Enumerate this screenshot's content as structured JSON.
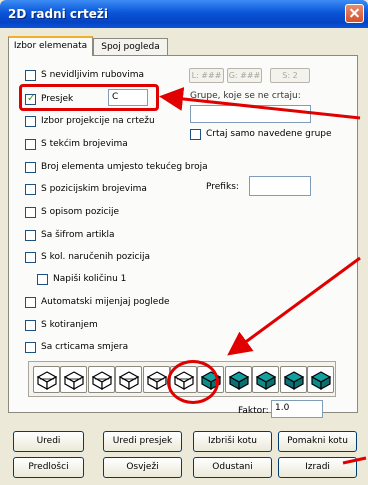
{
  "window": {
    "title": "2D radni crteži"
  },
  "tabs": [
    {
      "label": "Izbor elemenata",
      "active": true
    },
    {
      "label": "Spoj pogleda",
      "active": false
    }
  ],
  "options": [
    {
      "label": "S nevidljivim rubovima",
      "checked": false
    },
    {
      "label": "Presjek",
      "checked": true
    },
    {
      "label": "Izbor projekcije na crtežu",
      "checked": false
    },
    {
      "label": "S tekćim brojevima",
      "checked": false
    },
    {
      "label": "Broj elementa umjesto tekućeg broja",
      "checked": false
    },
    {
      "label": "S pozicijskim brojevima",
      "checked": false
    },
    {
      "label": "S opisom pozicije",
      "checked": false
    },
    {
      "label": "Sa šifrom artikla",
      "checked": false
    },
    {
      "label": "S kol. naručenih pozicija",
      "checked": false
    },
    {
      "label": "Napiši količinu 1",
      "checked": false
    },
    {
      "label": "Automatski mijenjaj poglede",
      "checked": false
    },
    {
      "label": "S kotiranjem",
      "checked": false
    },
    {
      "label": "Sa crticama smjera",
      "checked": false
    }
  ],
  "presjek_value": "C",
  "disabled_buttons": [
    "L: ###",
    "G: ###",
    "S: 2"
  ],
  "groups": {
    "label": "Grupe, koje se ne crtaju:",
    "value": "",
    "only_listed_label": "Crtaj samo navedene grupe",
    "only_listed_checked": false
  },
  "prefiks": {
    "label": "Prefiks:",
    "value": ""
  },
  "view_icons": [
    "view-iso-1-icon",
    "view-iso-2-icon",
    "view-iso-3-icon",
    "view-iso-4-icon",
    "view-iso-5-icon",
    "view-iso-6-icon",
    "view-iso-7-icon",
    "view-iso-8-icon",
    "view-iso-9-icon",
    "view-iso-10-icon",
    "view-iso-11-icon"
  ],
  "faktor": {
    "label": "Faktor:",
    "value": "1.0"
  },
  "buttons_row1": [
    "Uredi",
    "Uredi presjek",
    "Izbriši kotu",
    "Pomakni kotu"
  ],
  "buttons_row2": [
    "Predlošci",
    "Osvježi",
    "Odustani",
    "Izradi"
  ],
  "colors": {
    "annotation": "#e00000",
    "title_bar": "#0a56d8",
    "icon_teal": "#0e8a8a"
  }
}
